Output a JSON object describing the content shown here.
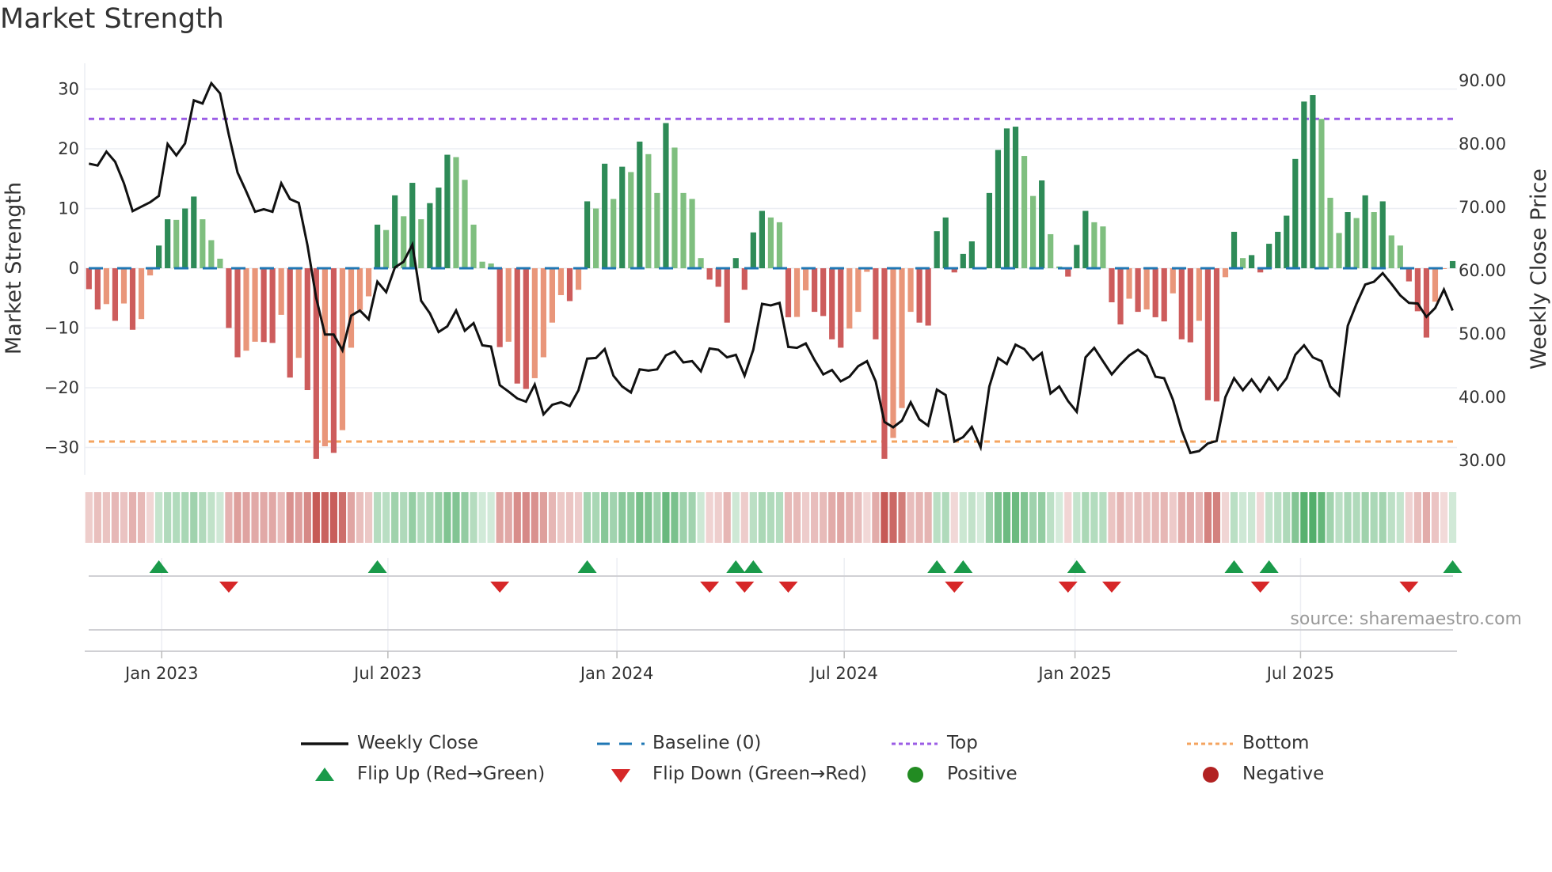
{
  "title": "Market Strength",
  "source": "source: sharemaestro.com",
  "colors": {
    "pos_strong": "#2e8b57",
    "pos_weak": "#7fbf7f",
    "neg_strong": "#cd5c5c",
    "neg_weak": "#e9967a",
    "heat_pos": "#45a85f",
    "heat_neg": "#c65a56",
    "baseline": "#1f77b4",
    "top": "#9b5de5",
    "bottom": "#f4a460",
    "line": "#111111",
    "flip_up": "#1a9a4a",
    "flip_down": "#d62728",
    "positive": "#228b22",
    "negative": "#b22222"
  },
  "legend": [
    {
      "key": "weekly_close",
      "label": "Weekly Close"
    },
    {
      "key": "baseline",
      "label": "Baseline (0)"
    },
    {
      "key": "top",
      "label": "Top"
    },
    {
      "key": "bottom",
      "label": "Bottom"
    },
    {
      "key": "flip_up",
      "label": "Flip Up (Red→Green)"
    },
    {
      "key": "flip_down",
      "label": "Flip Down (Green→Red)"
    },
    {
      "key": "positive",
      "label": "Positive"
    },
    {
      "key": "negative",
      "label": "Negative"
    }
  ],
  "chart_data": {
    "type": "bar",
    "title": "Market Strength",
    "ylabel": "Market Strength",
    "y2label": "Weekly Close Price",
    "ylim": [
      -34,
      34
    ],
    "y2lim": [
      29.2,
      94.2
    ],
    "yticks": [
      "30",
      "20",
      "10",
      "0",
      "−10",
      "−20",
      "−30"
    ],
    "ytick_values": [
      30,
      20,
      10,
      0,
      -10,
      -20,
      -30
    ],
    "y2ticks": [
      "90.00",
      "80.00",
      "70.00",
      "60.00",
      "50.00",
      "40.00",
      "30.00"
    ],
    "y2tick_values": [
      90,
      80,
      70,
      60,
      50,
      40,
      30
    ],
    "top_level": 25,
    "bottom_level": -29,
    "baseline": 0,
    "xticks": [
      {
        "label": "Jan 2023",
        "week": 8.33
      },
      {
        "label": "Jul 2023",
        "week": 34.2
      },
      {
        "label": "Jan 2024",
        "week": 60.4
      },
      {
        "label": "Jul 2024",
        "week": 86.4
      },
      {
        "label": "Jan 2025",
        "week": 112.8
      },
      {
        "label": "Jul 2025",
        "week": 138.6
      }
    ],
    "grid": true,
    "legend_position": "bottom",
    "series": [
      {
        "name": "Market Strength",
        "type": "bar",
        "values": [
          -3.5,
          -6.9,
          -6.0,
          -8.8,
          -5.9,
          -10.3,
          -8.5,
          -1.2,
          3.8,
          8.2,
          8.1,
          10.0,
          12.0,
          8.2,
          4.7,
          1.6,
          -10.0,
          -14.9,
          -13.8,
          -12.3,
          -12.35,
          -12.5,
          -7.8,
          -18.3,
          -15.0,
          -20.4,
          -31.9,
          -29.8,
          -30.9,
          -27.1,
          -13.3,
          -7.0,
          -4.7,
          7.3,
          6.4,
          12.2,
          8.7,
          14.3,
          8.2,
          10.9,
          13.5,
          19.0,
          18.6,
          14.8,
          7.3,
          1.1,
          0.8,
          -13.2,
          -12.3,
          -19.3,
          -20.2,
          -18.4,
          -14.9,
          -9.1,
          -4.5,
          -5.5,
          -3.6,
          11.2,
          10.0,
          17.5,
          11.6,
          17.0,
          16.1,
          21.2,
          19.1,
          12.6,
          24.3,
          20.2,
          12.6,
          11.6,
          1.7,
          -1.9,
          -3.1,
          -9.1,
          1.7,
          -3.6,
          6.0,
          9.6,
          8.5,
          7.7,
          -8.2,
          -8.15,
          -3.7,
          -7.3,
          -8.0,
          -11.9,
          -13.3,
          -10.1,
          -7.3,
          -0.6,
          -11.9,
          -31.9,
          -28.4,
          -23.4,
          -7.3,
          -9.1,
          -9.6,
          6.2,
          8.5,
          -0.7,
          2.4,
          4.5,
          0.2,
          12.6,
          19.8,
          23.4,
          23.7,
          18.8,
          12.1,
          14.7,
          5.7,
          0.3,
          -1.4,
          3.9,
          9.6,
          7.7,
          7.0,
          -5.7,
          -9.4,
          -5.1,
          -7.3,
          -6.9,
          -8.2,
          -8.9,
          -4.2,
          -11.9,
          -12.4,
          -8.8,
          -22.1,
          -22.3,
          -1.5,
          6.1,
          1.7,
          2.2,
          -0.7,
          4.1,
          6.1,
          8.8,
          18.3,
          27.9,
          29.0,
          25.0,
          11.8,
          5.9,
          9.4,
          8.4,
          12.2,
          9.4,
          11.2,
          5.5,
          3.8,
          -2.2,
          -7.2,
          -11.6,
          -5.6,
          -0.1,
          1.2
        ]
      },
      {
        "name": "Weekly Close",
        "type": "line",
        "axis": "right",
        "values": [
          76.9,
          76.6,
          78.8,
          77.2,
          73.8,
          69.4,
          70.1,
          70.8,
          71.8,
          80.0,
          78.2,
          80.1,
          86.9,
          86.4,
          89.6,
          88.0,
          81.5,
          75.5,
          72.5,
          69.3,
          69.7,
          69.3,
          73.8,
          71.3,
          70.7,
          64.0,
          55.7,
          49.9,
          49.9,
          47.4,
          52.9,
          53.7,
          52.3,
          58.25,
          56.6,
          60.5,
          61.4,
          64.1,
          55.25,
          53.25,
          50.3,
          51.2,
          53.7,
          50.5,
          51.7,
          48.2,
          48.0,
          41.9,
          40.9,
          39.8,
          39.3,
          42.0,
          37.3,
          38.8,
          39.2,
          38.6,
          41.1,
          46.1,
          46.2,
          47.6,
          43.4,
          41.7,
          40.75,
          44.4,
          44.2,
          44.4,
          46.6,
          47.25,
          45.5,
          45.7,
          44.1,
          47.7,
          47.5,
          46.3,
          46.7,
          43.4,
          47.5,
          54.75,
          54.5,
          54.9,
          47.95,
          47.8,
          48.5,
          45.9,
          43.6,
          44.3,
          42.5,
          43.25,
          44.9,
          45.7,
          42.5,
          36.1,
          35.25,
          36.3,
          39.2,
          36.5,
          35.5,
          41.2,
          40.35,
          33.0,
          33.7,
          35.3,
          32.1,
          41.7,
          46.2,
          45.25,
          48.3,
          47.6,
          45.9,
          47.0,
          40.6,
          41.7,
          39.4,
          37.7,
          46.3,
          47.8,
          45.7,
          43.6,
          45.2,
          46.6,
          47.5,
          46.5,
          43.25,
          43.0,
          39.6,
          34.8,
          31.2,
          31.5,
          32.7,
          33.1,
          40.0,
          43.0,
          41.1,
          42.8,
          40.9,
          43.1,
          41.2,
          43.0,
          46.7,
          48.2,
          46.3,
          45.7,
          41.7,
          40.3,
          51.3,
          54.75,
          57.8,
          58.25,
          59.6,
          57.9,
          56.1,
          54.9,
          54.8,
          52.7,
          54.1,
          57.0,
          53.7
        ]
      }
    ]
  }
}
